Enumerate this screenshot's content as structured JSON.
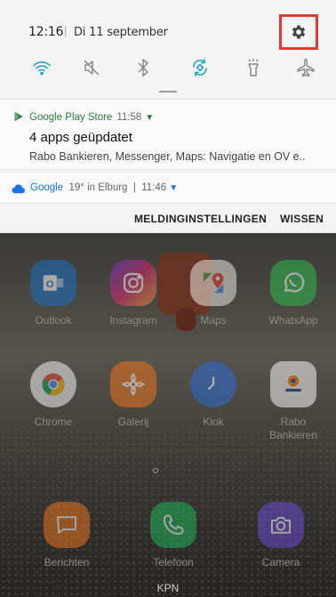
{
  "status": {
    "time": "12:16",
    "separator": "|",
    "date": "Di 11 september"
  },
  "quick_settings": [
    {
      "icon": "wifi-icon",
      "state": "on"
    },
    {
      "icon": "sound-mute-icon",
      "state": "off"
    },
    {
      "icon": "bluetooth-icon",
      "state": "off"
    },
    {
      "icon": "auto-rotate-icon",
      "state": "on"
    },
    {
      "icon": "flashlight-icon",
      "state": "off"
    },
    {
      "icon": "airplane-icon",
      "state": "off"
    }
  ],
  "notifications": [
    {
      "app": "Google Play Store",
      "time": "11:58",
      "title": "4 apps geüpdatet",
      "body": "Rabo Bankieren, Messenger, Maps: Navigatie en OV e.."
    },
    {
      "app": "Google",
      "detail": "19° in Elburg",
      "separator": "|",
      "time": "11:46"
    }
  ],
  "actions": {
    "settings_label": "MELDINGINSTELLINGEN",
    "clear_label": "WISSEN"
  },
  "home": {
    "row1": [
      {
        "label": "Outlook"
      },
      {
        "label": "Instagram"
      },
      {
        "label": "Maps"
      },
      {
        "label": "WhatsApp"
      }
    ],
    "row2": [
      {
        "label": "Chrome"
      },
      {
        "label": "Galerij"
      },
      {
        "label": "Klok"
      },
      {
        "label": "Rabo\nBankieren"
      }
    ],
    "dock": [
      {
        "label": "Berichten"
      },
      {
        "label": "Telefoon"
      },
      {
        "label": "Camera"
      }
    ],
    "carrier": "KPN"
  },
  "colors": {
    "accent_teal": "#1aa3c8",
    "highlight_box": "#e53a2d",
    "play_green": "#2a7a3f",
    "google_blue": "#1a73e8"
  }
}
